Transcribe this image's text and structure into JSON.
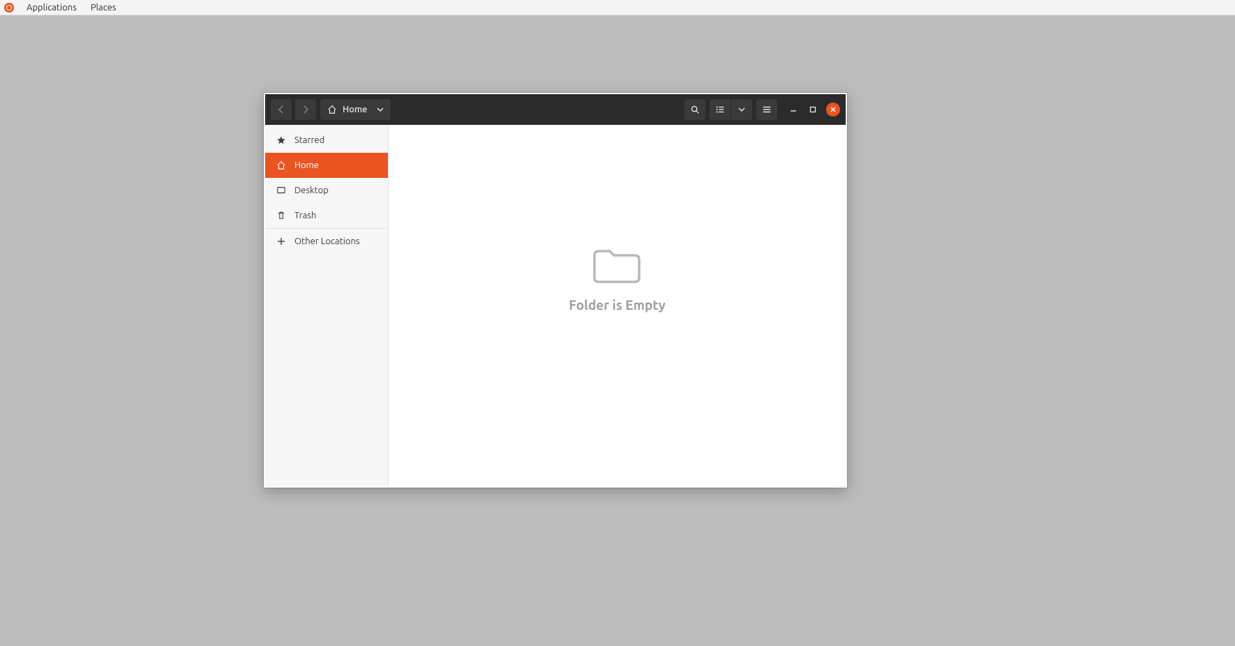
{
  "system_menubar": {
    "items": [
      "Applications",
      "Places"
    ]
  },
  "window": {
    "headerbar": {
      "path_label": "Home"
    },
    "sidebar": {
      "items": [
        {
          "label": "Starred",
          "icon": "star"
        },
        {
          "label": "Home",
          "icon": "home",
          "selected": true
        },
        {
          "label": "Desktop",
          "icon": "desktop"
        },
        {
          "label": "Trash",
          "icon": "trash"
        }
      ],
      "other_locations_label": "Other Locations"
    },
    "content": {
      "empty_message": "Folder is Empty"
    }
  }
}
